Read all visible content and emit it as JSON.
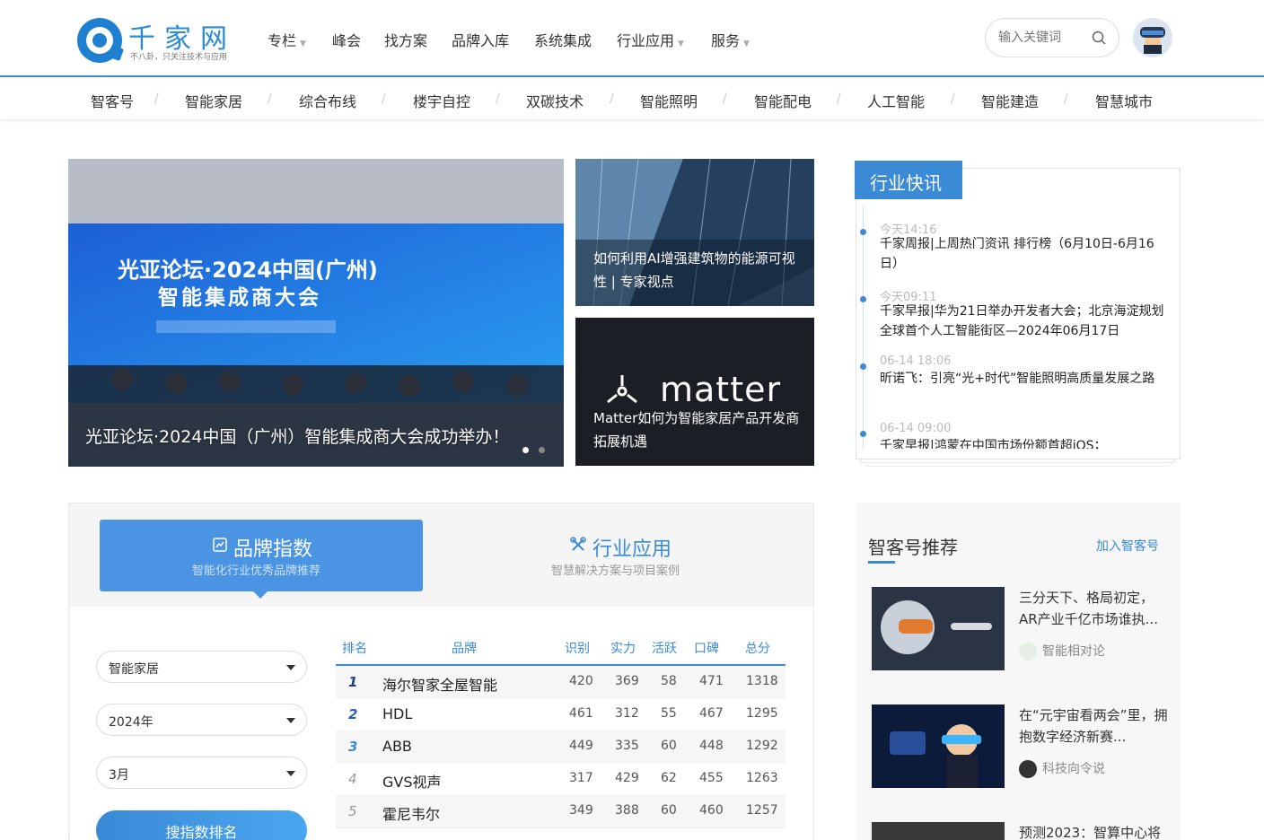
{
  "header": {
    "logo_text": "千家网",
    "logo_tagline": "不八卦，只关注技术与应用",
    "nav": [
      {
        "label": "专栏",
        "dropdown": true
      },
      {
        "label": "峰会",
        "dropdown": false
      },
      {
        "label": "找方案",
        "dropdown": false
      },
      {
        "label": "品牌入库",
        "dropdown": false
      },
      {
        "label": "系统集成",
        "dropdown": false
      },
      {
        "label": "行业应用",
        "dropdown": true
      },
      {
        "label": "服务",
        "dropdown": true
      }
    ],
    "search_placeholder": "输入关键词",
    "accent_color": "#3a8ad6"
  },
  "subnav": [
    "智客号",
    "智能家居",
    "综合布线",
    "楼宇自控",
    "双碳技术",
    "智能照明",
    "智能配电",
    "人工智能",
    "智能建造",
    "智慧城市"
  ],
  "hero": {
    "main_caption": "光亚论坛·2024中国（广州）智能集成商大会成功举办！",
    "banner_line1": "光亚论坛·2024中国(广州)",
    "banner_line2": "智能集成商大会",
    "side1_caption": "如何利用AI增强建筑物的能源可视性 | 专家视点",
    "side2_brand": "matter",
    "side2_caption": "Matter如何为智能家居产品开发商拓展机遇"
  },
  "flash": {
    "tab": "行业快讯",
    "items": [
      {
        "time": "今天14:16",
        "title": "千家周报|上周热门资讯 排行榜（6月10日-6月16日）"
      },
      {
        "time": "今天09:11",
        "title": "千家早报|华为21日举办开发者大会；北京海淀规划全球首个人工智能街区—2024年06月17日"
      },
      {
        "time": "06-14 18:06",
        "title": "昕诺飞：引亮“光+时代”智能照明高质量发展之路"
      },
      {
        "time": "06-14 09:00",
        "title": "千家早报|鸿蒙在中国市场份额首超iOS；"
      }
    ]
  },
  "index": {
    "tab_active_title": "品牌指数",
    "tab_active_sub": "智能化行业优秀品牌推荐",
    "tab_other_title": "行业应用",
    "tab_other_sub": "智慧解决方案与项目案例",
    "filters": [
      "智能家居",
      "2024年",
      "3月"
    ],
    "search_button": "搜指数排名",
    "headers": [
      "排名",
      "品牌",
      "识别",
      "实力",
      "活跃",
      "口碑",
      "总分"
    ],
    "rows": [
      {
        "rank": "1",
        "brand": "海尔智家全屋智能",
        "a": "420",
        "b": "369",
        "c": "58",
        "d": "471",
        "total": "1318"
      },
      {
        "rank": "2",
        "brand": "HDL",
        "a": "461",
        "b": "312",
        "c": "55",
        "d": "467",
        "total": "1295"
      },
      {
        "rank": "3",
        "brand": "ABB",
        "a": "449",
        "b": "335",
        "c": "60",
        "d": "448",
        "total": "1292"
      },
      {
        "rank": "4",
        "brand": "GVS视声",
        "a": "317",
        "b": "429",
        "c": "62",
        "d": "455",
        "total": "1263"
      },
      {
        "rank": "5",
        "brand": "霍尼韦尔",
        "a": "349",
        "b": "388",
        "c": "60",
        "d": "460",
        "total": "1257"
      }
    ]
  },
  "recommend": {
    "title": "智客号推荐",
    "join": "加入智客号",
    "items": [
      {
        "title": "三分天下、格局初定，AR产业千亿市场谁执...",
        "author": "智能相对论"
      },
      {
        "title": "在“元宇宙看两会”里，拥抱数字经济新赛...",
        "author": "科技向令说"
      },
      {
        "title": "预测2023：智算中心将",
        "author": ""
      }
    ]
  }
}
